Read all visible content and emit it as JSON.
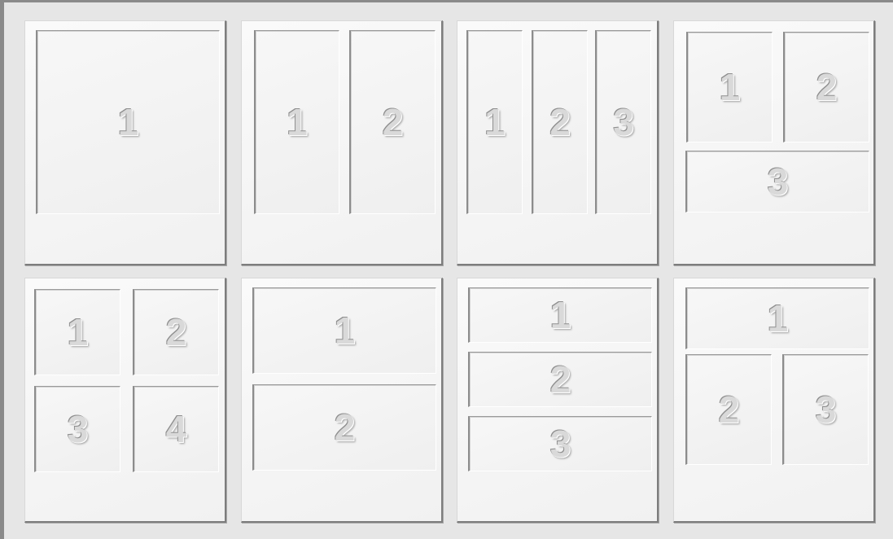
{
  "layouts": [
    {
      "name": "one-panel",
      "panels": [
        "1"
      ]
    },
    {
      "name": "two-columns",
      "panels": [
        "1",
        "2"
      ]
    },
    {
      "name": "three-columns",
      "panels": [
        "1",
        "2",
        "3"
      ]
    },
    {
      "name": "two-top-one-bottom",
      "panels": [
        "1",
        "2",
        "3"
      ]
    },
    {
      "name": "four-grid",
      "panels": [
        "1",
        "2",
        "3",
        "4"
      ]
    },
    {
      "name": "two-rows",
      "panels": [
        "1",
        "2"
      ]
    },
    {
      "name": "three-rows",
      "panels": [
        "1",
        "2",
        "3"
      ]
    },
    {
      "name": "one-top-two-bottom",
      "panels": [
        "1",
        "2",
        "3"
      ]
    }
  ]
}
